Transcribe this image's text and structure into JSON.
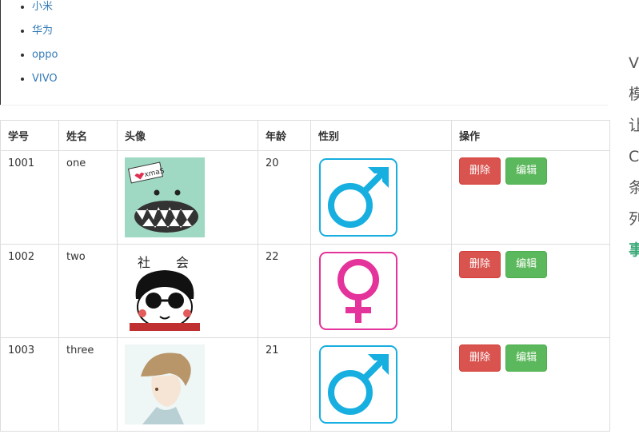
{
  "brands": [
    "小米",
    "华为",
    "oppo",
    "VIVO"
  ],
  "table": {
    "headers": [
      "学号",
      "姓名",
      "头像",
      "年龄",
      "性别",
      "操作"
    ],
    "rows": [
      {
        "id": "1001",
        "name": "one",
        "age": "20",
        "gender": "male"
      },
      {
        "id": "1002",
        "name": "two",
        "age": "22",
        "gender": "female"
      },
      {
        "id": "1003",
        "name": "three",
        "age": "21",
        "gender": "male"
      }
    ],
    "delete_label": "删除",
    "edit_label": "编辑"
  },
  "avatar_texts": {
    "xmas_tag": "xmaS",
    "meme_caption_1": "社",
    "meme_caption_2": "会"
  },
  "side_glyphs": [
    "Vu",
    "模",
    "让",
    "C",
    "条",
    "列",
    "事"
  ],
  "colors": {
    "male": "#17aee0",
    "female": "#e4339a",
    "link": "#337ab7",
    "danger": "#d9534f",
    "success": "#5cb85c"
  }
}
